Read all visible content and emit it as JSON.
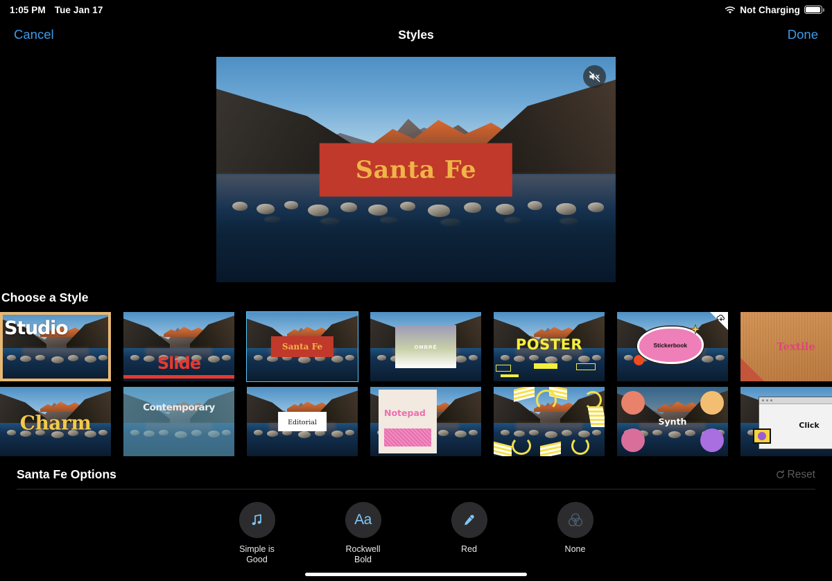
{
  "status_bar": {
    "time": "1:05 PM",
    "date": "Tue Jan 17",
    "battery_text": "Not Charging",
    "wifi_icon": "wifi-icon",
    "battery_icon": "battery-icon"
  },
  "nav": {
    "cancel_label": "Cancel",
    "title": "Styles",
    "done_label": "Done"
  },
  "preview": {
    "title_text": "Santa Fe",
    "title_bg_color": "#C0392B",
    "title_text_color": "#F0B448",
    "mute_icon": "speaker-mute-icon"
  },
  "styles_section": {
    "heading": "Choose a Style",
    "selected_style": "Santa Fe",
    "rows": [
      [
        {
          "name": "Studio",
          "label": "Studio",
          "selected": false,
          "needs_download": false
        },
        {
          "name": "Slide",
          "label": "Slide",
          "selected": false,
          "needs_download": false
        },
        {
          "name": "Santa Fe",
          "label": "Santa Fe",
          "selected": true,
          "needs_download": false
        },
        {
          "name": "Ombre",
          "label": "OMBRÉ",
          "selected": false,
          "needs_download": false
        },
        {
          "name": "Poster",
          "label": "POSTER",
          "selected": false,
          "needs_download": false
        },
        {
          "name": "Stickerbook",
          "label": "Stickerbook",
          "selected": false,
          "needs_download": true
        },
        {
          "name": "Textile",
          "label": "Textile",
          "selected": false,
          "needs_download": false
        }
      ],
      [
        {
          "name": "Charm",
          "label": "Charm",
          "selected": false,
          "needs_download": false
        },
        {
          "name": "Contemporary",
          "label": "Contemporary",
          "selected": false,
          "needs_download": false
        },
        {
          "name": "Editorial",
          "label": "Editorial",
          "selected": false,
          "needs_download": false
        },
        {
          "name": "Notepad",
          "label": "Notepad",
          "selected": false,
          "needs_download": false
        },
        {
          "name": "Pattern",
          "label": "",
          "selected": false,
          "needs_download": false
        },
        {
          "name": "Synth",
          "label": "Synth",
          "selected": false,
          "needs_download": false
        },
        {
          "name": "Click",
          "label": "Click",
          "selected": false,
          "needs_download": false
        }
      ]
    ]
  },
  "options_section": {
    "title": "Santa Fe Options",
    "reset_label": "Reset",
    "reset_icon": "refresh-icon",
    "options": [
      {
        "icon": "music-note-icon",
        "label": "Simple is Good"
      },
      {
        "icon": "text-format-icon",
        "label": "Rockwell Bold",
        "glyph": "Aa"
      },
      {
        "icon": "eyedropper-icon",
        "label": "Red"
      },
      {
        "icon": "filter-circles-icon",
        "label": "None"
      }
    ]
  },
  "accent_colors": {
    "tint_blue": "#3C9BEC",
    "selection_blue": "#5AC8FA",
    "santafe_red": "#C0392B",
    "santafe_gold": "#F0B448"
  }
}
